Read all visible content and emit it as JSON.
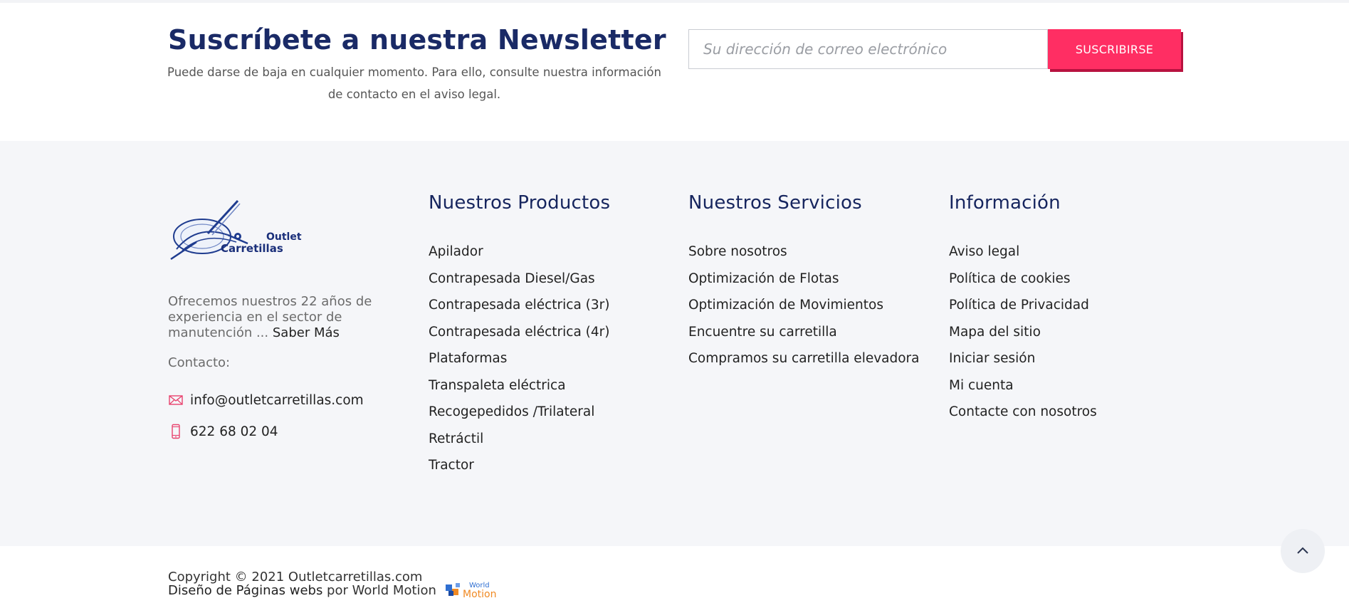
{
  "newsletter": {
    "title": "Suscríbete a nuestra Newsletter",
    "description": "Puede darse de baja en cualquier momento. Para ello, consulte nuestra información de contacto en el aviso legal.",
    "email_placeholder": "Su dirección de correo electrónico",
    "subscribe_label": "SUSCRIBIRSE"
  },
  "brand": {
    "logo_line1": "Outlet",
    "logo_line2": "Carretillas",
    "about_text": "Ofrecemos nuestros 22 años de experiencia en el sector de manutención ... ",
    "about_link": "Saber Más",
    "contact_label": "Contacto:",
    "email": "info@outletcarretillas.com",
    "phone": "622 68 02 04",
    "accent_color": "#ff2e63",
    "heading_color": "#16255e"
  },
  "products": {
    "title": "Nuestros Productos",
    "items": [
      "Apilador",
      "Contrapesada Diesel/Gas",
      "Contrapesada eléctrica (3r)",
      "Contrapesada eléctrica (4r)",
      "Plataformas",
      "Transpaleta eléctrica",
      "Recogepedidos /Trilateral",
      "Retráctil",
      "Tractor"
    ]
  },
  "services": {
    "title": "Nuestros Servicios",
    "items": [
      "Sobre nosotros",
      "Optimización de Flotas",
      "Optimización de Movimientos",
      "Encuentre su carretilla",
      "Compramos su carretilla elevadora"
    ]
  },
  "info": {
    "title": "Información",
    "items": [
      "Aviso legal",
      "Política de cookies",
      "Política de Privacidad",
      "Mapa del sitio",
      "Iniciar sesión",
      "Mi cuenta",
      "Contacte con nosotros"
    ]
  },
  "bottom": {
    "copyright": "Copyright © 2021 Outletcarretillas.com",
    "credit_link": "Diseño de Páginas webs",
    "credit_by": " por World Motion",
    "wm_logo_line1": "World",
    "wm_logo_line2": "Motion"
  },
  "icons": {
    "email": "envelope-icon",
    "phone": "mobile-phone-icon",
    "back_to_top": "chevron-up-icon"
  }
}
